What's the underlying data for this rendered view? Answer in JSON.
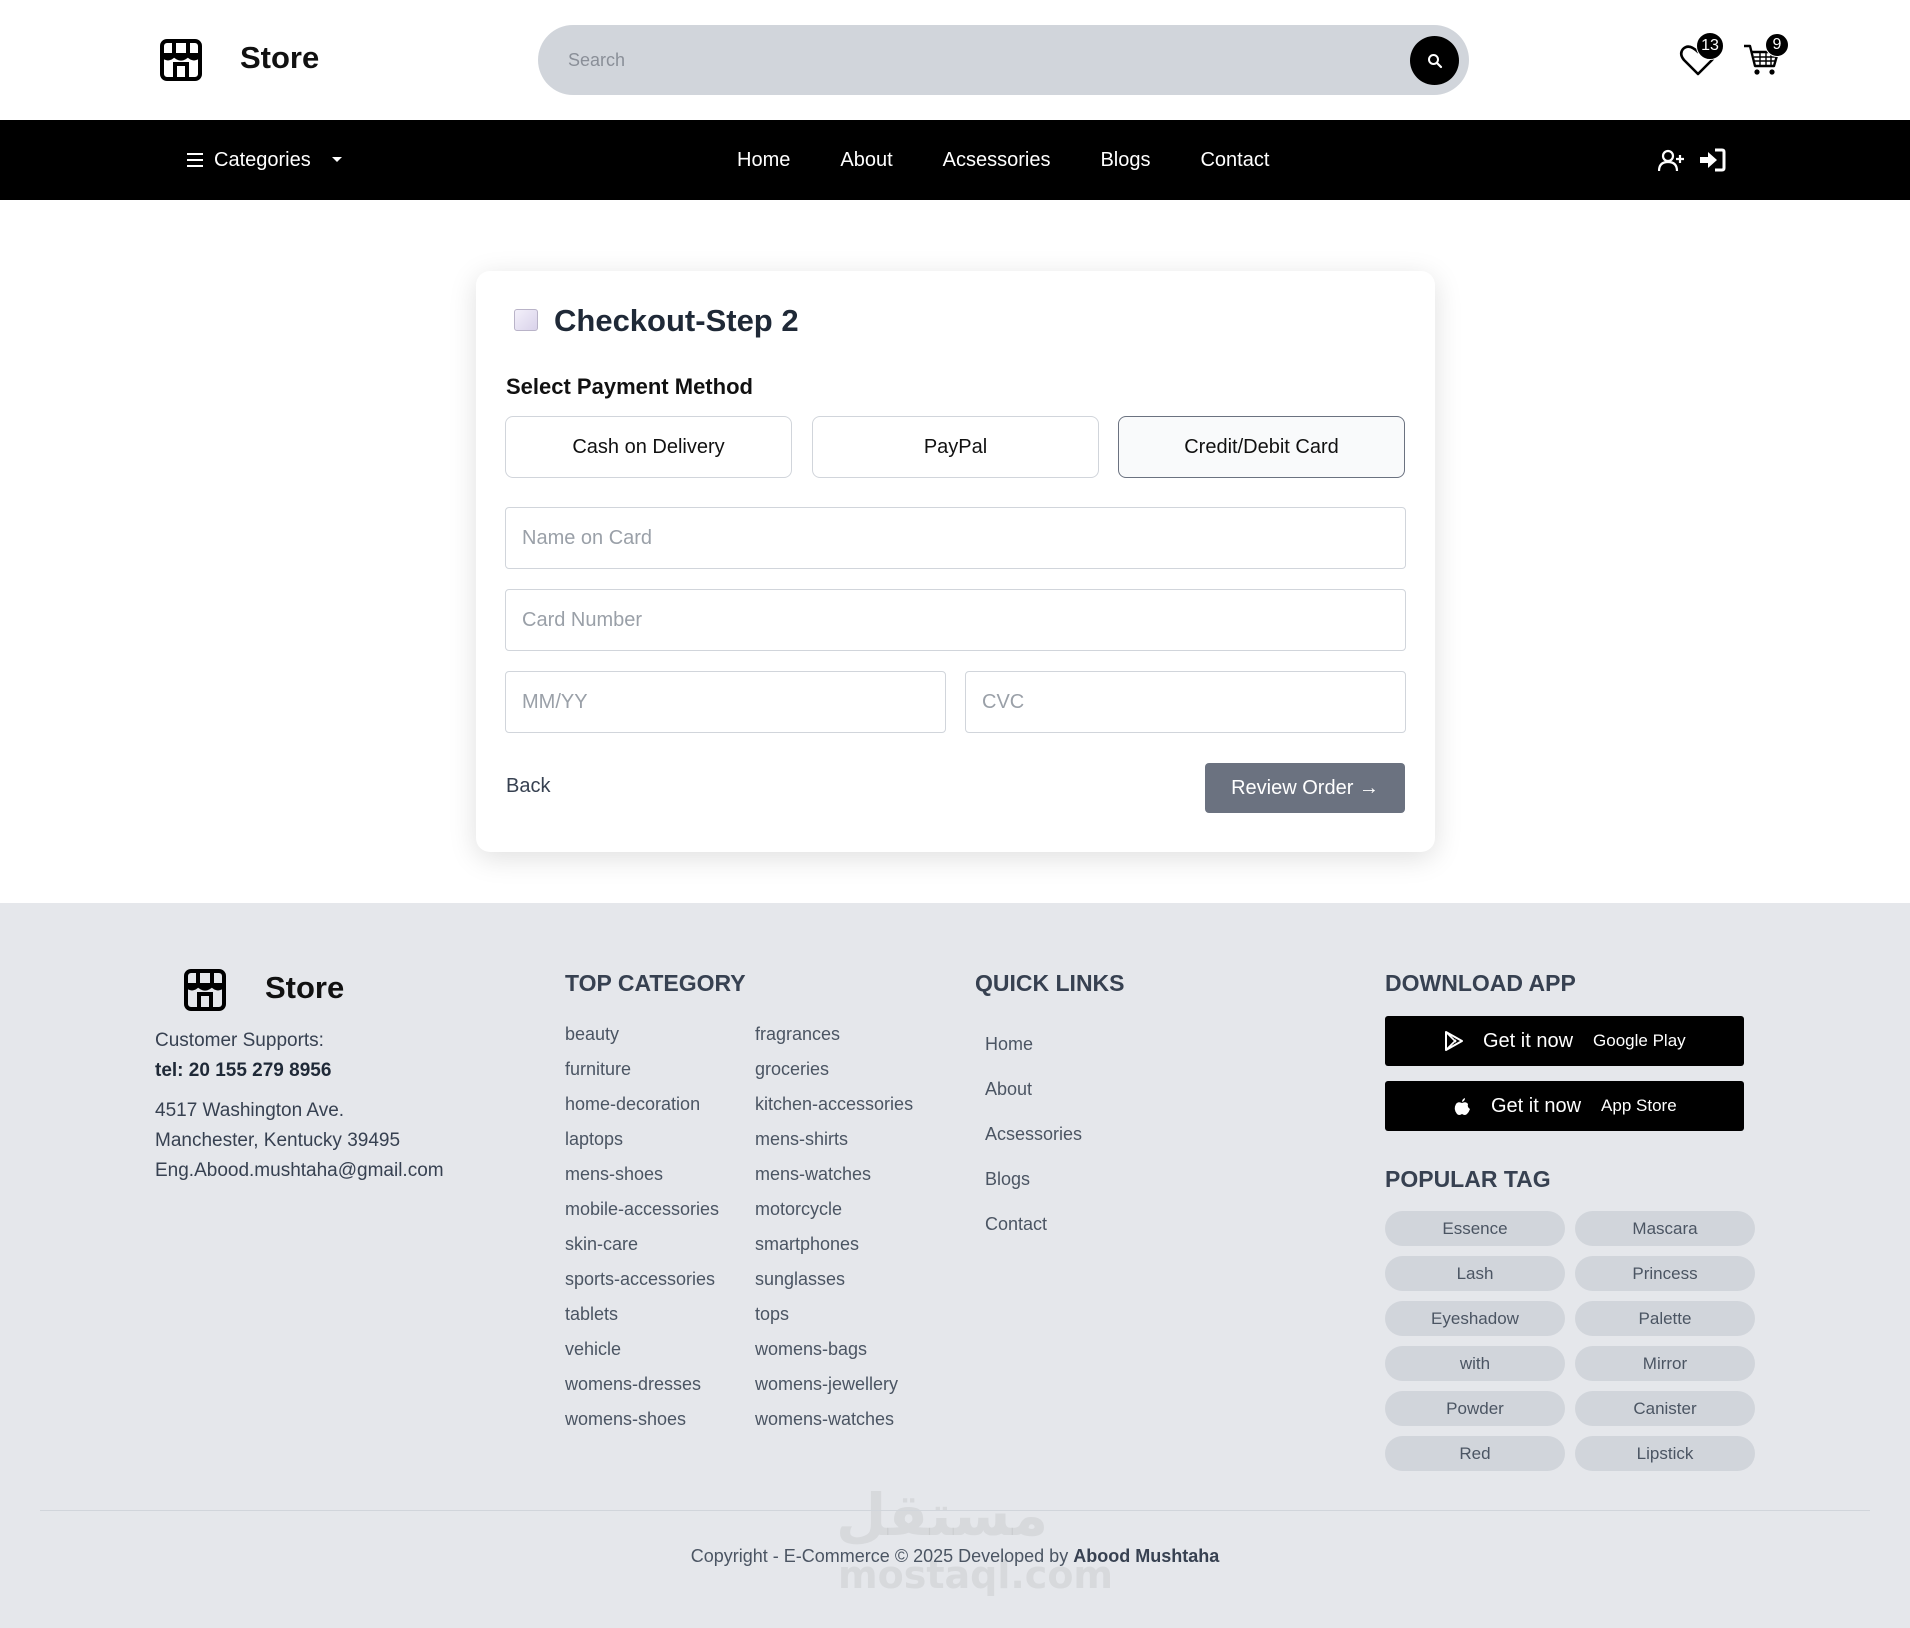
{
  "header": {
    "brand": "Store",
    "search_placeholder": "Search",
    "wishlist_count": "13",
    "cart_count": "9"
  },
  "nav": {
    "categories_label": "Categories",
    "links": [
      "Home",
      "About",
      "Acsessories",
      "Blogs",
      "Contact"
    ]
  },
  "checkout": {
    "title": "Checkout-Step 2",
    "payment_label": "Select Payment Method",
    "methods": [
      "Cash on Delivery",
      "PayPal",
      "Credit/Debit Card"
    ],
    "selected_method": "Credit/Debit Card",
    "name_placeholder": "Name on Card",
    "number_placeholder": "Card Number",
    "expiry_placeholder": "MM/YY",
    "cvc_placeholder": "CVC",
    "back_label": "Back",
    "review_label": "Review Order →"
  },
  "footer": {
    "brand": "Store",
    "support_label": "Customer Supports:",
    "tel": "tel: 20 155 279 8956",
    "address1": "4517 Washington Ave.",
    "address2": "Manchester, Kentucky 39495",
    "email": "Eng.Abood.mushtaha@gmail.com",
    "top_category_heading": "TOP CATEGORY",
    "categories_col1": [
      "beauty",
      "furniture",
      "home-decoration",
      "laptops",
      "mens-shoes",
      "mobile-accessories",
      "skin-care",
      "sports-accessories",
      "tablets",
      "vehicle",
      "womens-dresses",
      "womens-shoes"
    ],
    "categories_col2": [
      "fragrances",
      "groceries",
      "kitchen-accessories",
      "mens-shirts",
      "mens-watches",
      "motorcycle",
      "smartphones",
      "sunglasses",
      "tops",
      "womens-bags",
      "womens-jewellery",
      "womens-watches"
    ],
    "quick_links_heading": "QUICK LINKS",
    "quick_links": [
      "Home",
      "About",
      "Acsessories",
      "Blogs",
      "Contact"
    ],
    "download_heading": "DOWNLOAD APP",
    "google_play": {
      "cta": "Get it now",
      "store": "Google Play"
    },
    "app_store": {
      "cta": "Get it now",
      "store": "App Store"
    },
    "popular_tag_heading": "POPULAR TAG",
    "tags": [
      "Essence",
      "Mascara",
      "Lash",
      "Princess",
      "Eyeshadow",
      "Palette",
      "with",
      "Mirror",
      "Powder",
      "Canister",
      "Red",
      "Lipstick"
    ],
    "copyright_prefix": "Copyright - E-Commerce © 2025 Developed by",
    "developer": "Abood Mushtaha"
  },
  "watermark": {
    "arabic": "مستقل",
    "latin": "mostaql.com"
  },
  "icons": [
    "store-icon",
    "search-icon",
    "heart-icon",
    "cart-icon",
    "menu-icon",
    "caret-down-icon",
    "user-plus-icon",
    "sign-in-icon",
    "card-icon",
    "google-play-icon",
    "apple-icon"
  ]
}
